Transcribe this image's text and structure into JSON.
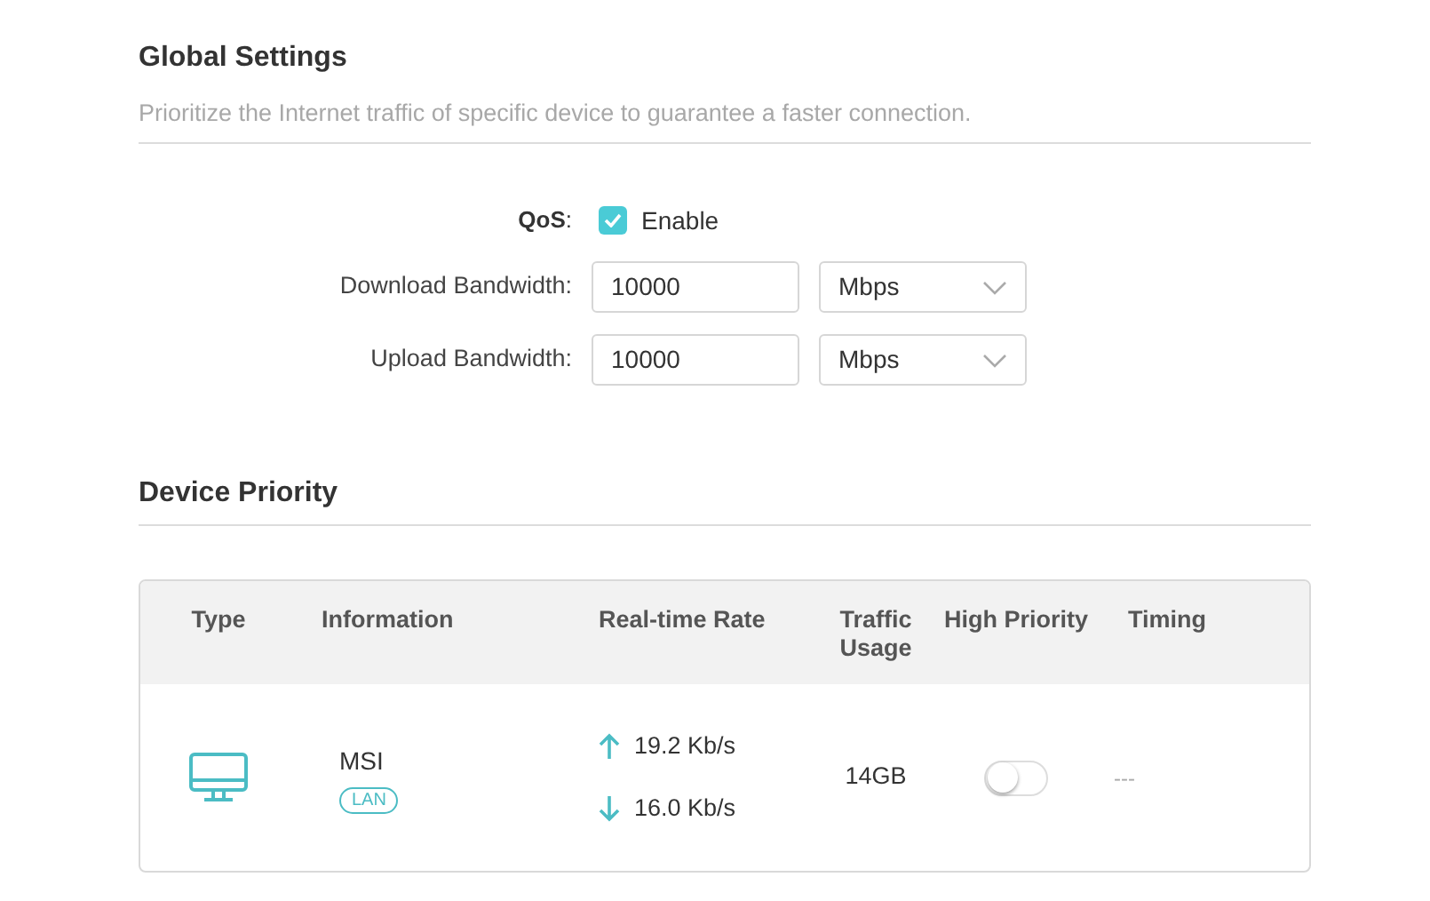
{
  "global_settings": {
    "title": "Global Settings",
    "description": "Prioritize the Internet traffic of specific device to guarantee a faster connection.",
    "qos": {
      "label": "QoS",
      "colon": ":",
      "checked": true,
      "option": "Enable"
    },
    "fields": [
      {
        "label": "Download Bandwidth:",
        "value": "10000",
        "unit": "Mbps"
      },
      {
        "label": "Upload Bandwidth:",
        "value": "10000",
        "unit": "Mbps"
      }
    ]
  },
  "device_priority": {
    "title": "Device Priority",
    "table": {
      "columns": [
        "Type",
        "Information",
        "Real-time Rate",
        "Traffic Usage",
        "High Priority",
        "Timing"
      ],
      "rows": [
        {
          "name": "MSI",
          "connection": "LAN",
          "upload": "19.2 Kb/s",
          "download": "16.0 Kb/s",
          "usage": "14GB",
          "high_priority": false,
          "timing": "---"
        }
      ]
    }
  }
}
